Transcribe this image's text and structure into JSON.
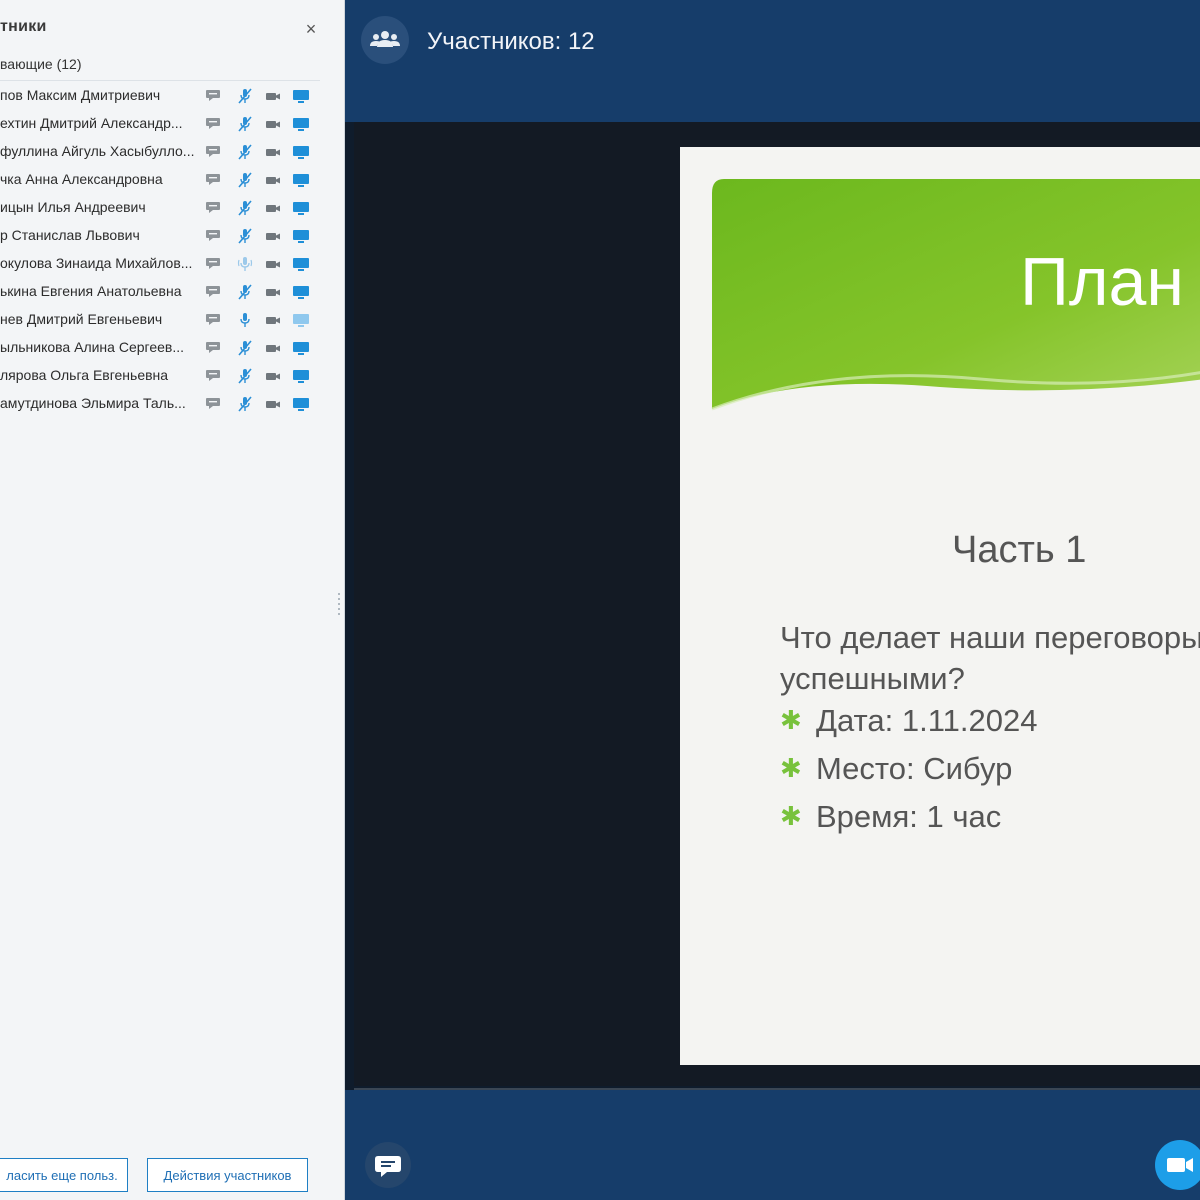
{
  "participants_panel": {
    "title": "тники",
    "close_label": "×",
    "group_title": "вающие (12)",
    "participants": [
      {
        "name": "пов Максим Дмитриевич",
        "mic": "muted"
      },
      {
        "name": "ехтин Дмитрий Александр...",
        "mic": "muted"
      },
      {
        "name": "фуллина Айгуль Хасыбулло...",
        "mic": "muted"
      },
      {
        "name": "чка Анна Александровна",
        "mic": "muted"
      },
      {
        "name": "ицын Илья Андреевич",
        "mic": "muted"
      },
      {
        "name": "р Станислав Львович",
        "mic": "muted"
      },
      {
        "name": "окулова Зинаида Михайлов...",
        "mic": "speaking"
      },
      {
        "name": "ькина Евгения Анатольевна",
        "mic": "muted"
      },
      {
        "name": "нев Дмитрий Евгеньевич",
        "mic": "on"
      },
      {
        "name": "ыльникова Алина Сергеев...",
        "mic": "muted"
      },
      {
        "name": "лярова Ольга Евгеньевна",
        "mic": "muted"
      },
      {
        "name": "амутдинова Эльмира Таль...",
        "mic": "muted"
      }
    ],
    "footer": {
      "invite_label": "ласить еще польз.",
      "actions_label": "Действия участников"
    }
  },
  "top_bar": {
    "participants_label": "Участников: 12",
    "icon": "people-icon"
  },
  "slide": {
    "title": "План",
    "subtitle": "Часть 1",
    "question": "Что делает наши переговоры успешными?",
    "bullets": [
      "Дата: 1.11.2024",
      "Место: Сибур",
      "Время: 1 час"
    ]
  },
  "bottom_bar": {
    "chat_icon": "chat-icon",
    "video_icon": "video-icon"
  },
  "colors": {
    "topbar": "#163d6a",
    "accent": "#1f7fc4",
    "slide_green": "#6cb81e",
    "icon_blue": "#1e8fd8"
  }
}
